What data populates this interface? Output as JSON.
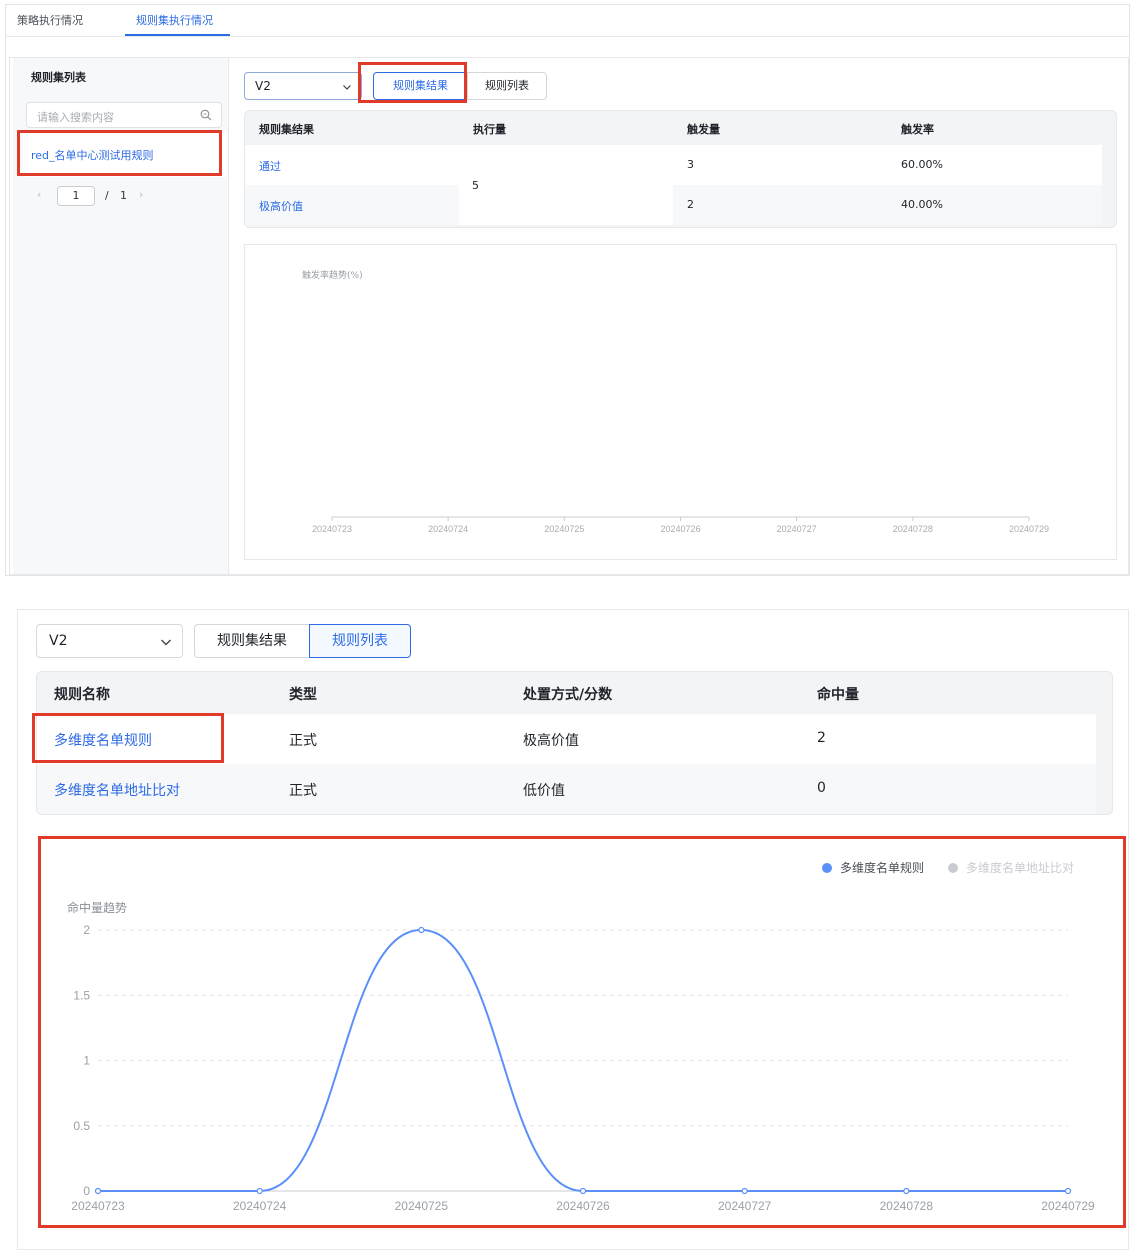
{
  "panel1": {
    "tabs": [
      {
        "label": "策略执行情况",
        "active": false
      },
      {
        "label": "规则集执行情况",
        "active": true
      }
    ],
    "left": {
      "title": "规则集列表",
      "search_placeholder": "请输入搜索内容",
      "rule_item": "red_名单中心测试用规则",
      "pagination": {
        "prev": "‹",
        "current": "1",
        "separator": "/",
        "total": "1",
        "next": "›"
      }
    },
    "version_select": {
      "value": "V2"
    },
    "segments": {
      "result": "规则集结果",
      "list": "规则列表"
    },
    "table": {
      "headers": [
        "规则集结果",
        "执行量",
        "触发量",
        "触发率"
      ],
      "rows": [
        {
          "result": "通过",
          "trigger_count": "3",
          "trigger_rate": "60.00%"
        },
        {
          "result": "极高价值",
          "trigger_count": "2",
          "trigger_rate": "40.00%"
        }
      ],
      "exec_count_merged": "5"
    },
    "chart_data": {
      "type": "line",
      "title": "触发率趋势(%)",
      "x": [
        "20240723",
        "20240724",
        "20240725",
        "20240726",
        "20240727",
        "20240728",
        "20240729"
      ],
      "series": [],
      "grid": false
    }
  },
  "panel2": {
    "version_select": {
      "value": "V2"
    },
    "segments": {
      "result": "规则集结果",
      "list": "规则列表"
    },
    "table": {
      "headers": [
        "规则名称",
        "类型",
        "处置方式/分数",
        "命中量"
      ],
      "rows": [
        {
          "name": "多维度名单规则",
          "type": "正式",
          "action": "极高价值",
          "hits": "2"
        },
        {
          "name": "多维度名单地址比对",
          "type": "正式",
          "action": "低价值",
          "hits": "0"
        }
      ]
    },
    "chart_data": {
      "type": "line",
      "title": "命中量趋势",
      "x": [
        "20240723",
        "20240724",
        "20240725",
        "20240726",
        "20240727",
        "20240728",
        "20240729"
      ],
      "series": [
        {
          "name": "多维度名单规则",
          "values": [
            0,
            0,
            2,
            0,
            0,
            0,
            0
          ],
          "color": "#5b8ff9",
          "active": true
        },
        {
          "name": "多维度名单地址比对",
          "values": [
            0,
            0,
            0,
            0,
            0,
            0,
            0
          ],
          "color": "#c8cbd0",
          "active": false
        }
      ],
      "ylim": [
        0,
        2
      ],
      "yticks": [
        "0",
        "0.5",
        "1",
        "1.5",
        "2"
      ],
      "legend": "top-right",
      "grid": true,
      "smooth": true
    }
  },
  "colors": {
    "accent": "#2d6be4",
    "annotation": "#e03a2a",
    "line": "#5b8ff9"
  }
}
